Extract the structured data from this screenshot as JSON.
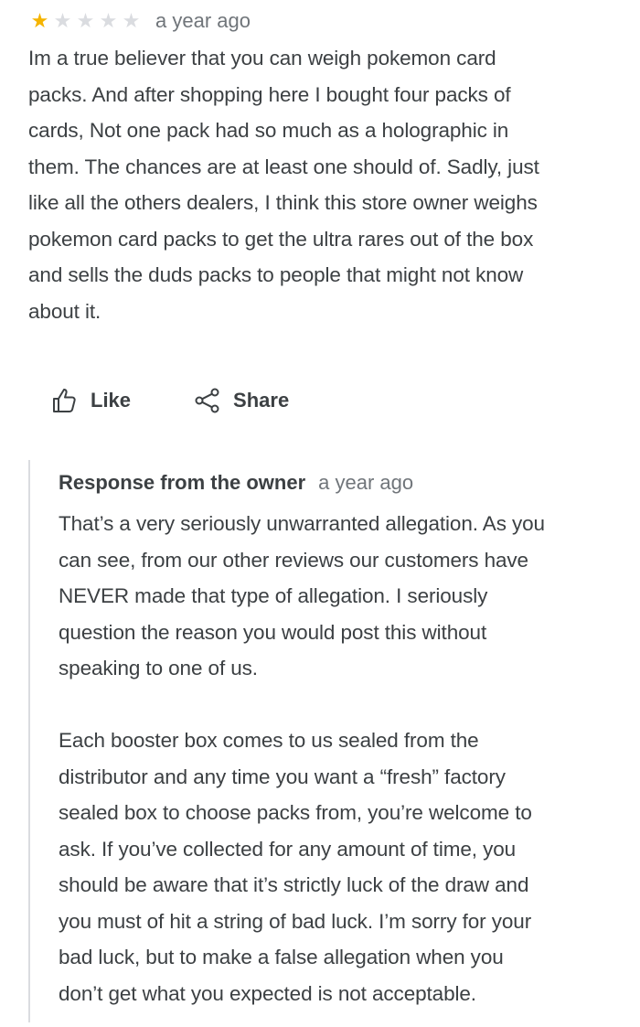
{
  "review": {
    "rating": 1,
    "max_rating": 5,
    "time": "a year ago",
    "text_lines": [
      "Im a true believer that you can weigh pokemon card",
      "packs. And after shopping here I bought four packs of",
      "cards, Not one pack had so much as a holographic in",
      "them. The chances are at least one should of. Sadly, just",
      "like all the others dealers, I think this store owner weighs",
      "pokemon card packs to get the ultra rares out of the box",
      "and sells the duds packs to people that might not know",
      "about it."
    ]
  },
  "actions": {
    "like_label": "Like",
    "like_icon": "thumbs-up-icon",
    "share_label": "Share",
    "share_icon": "share-icon"
  },
  "owner_response": {
    "title": "Response from the owner",
    "time": "a year ago",
    "paragraph1_lines": [
      "That’s a very seriously unwarranted allegation. As you",
      "can see, from our other reviews our customers have",
      "NEVER made that type of allegation. I seriously",
      "question the reason you would post this without",
      "speaking to one of us."
    ],
    "paragraph2_lines": [
      "Each booster box comes to us sealed from the",
      "distributor and any time you want a “fresh” factory",
      "sealed box to choose packs from, you’re welcome to",
      "ask. If you’ve collected for any amount of time, you",
      "should be aware that it’s strictly luck of the draw and",
      "you must of hit a string of bad luck. I’m sorry for your",
      "bad luck, but to make a false allegation when you",
      "don’t get what you expected is not acceptable."
    ]
  },
  "colors": {
    "star_filled": "#f5b400",
    "star_empty": "#dadce0",
    "text": "#3c4043",
    "muted": "#70757a"
  }
}
